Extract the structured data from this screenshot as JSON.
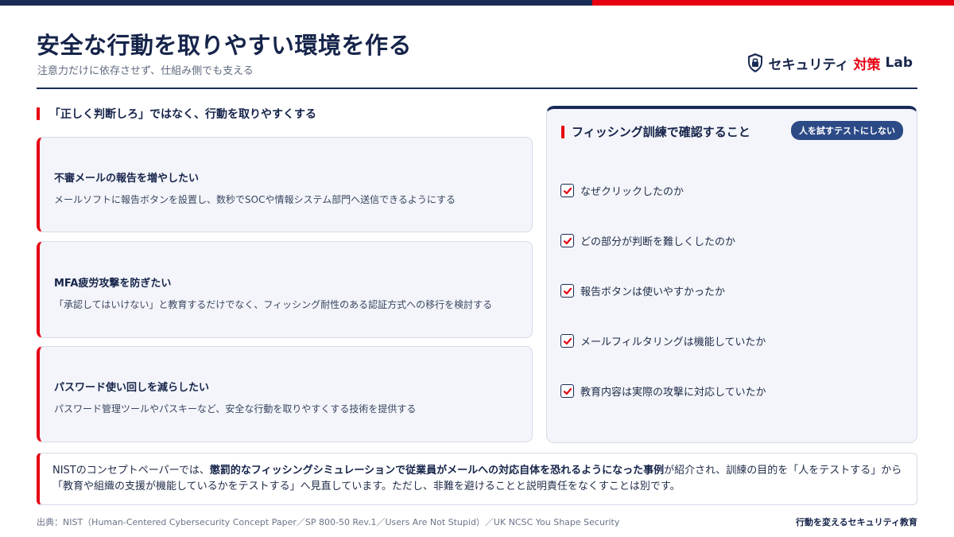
{
  "colors": {
    "navy": "#1a2b55",
    "accent_red": "#e60012",
    "card_bg": "#f3f5fa",
    "pill_bg": "#2c4a86"
  },
  "header": {
    "title": "安全な行動を取りやすい環境を作る",
    "subtitle": "注意力だけに依存させず、仕組み側でも支える"
  },
  "brand": {
    "icon": "shield-lock-icon",
    "name_main": "セキュリティ",
    "name_accent": "対策",
    "name_suffix": "Lab"
  },
  "left": {
    "heading": "「正しく判断しろ」ではなく、行動を取りやすくする",
    "cards": [
      {
        "title": "不審メールの報告を増やしたい",
        "desc": "メールソフトに報告ボタンを設置し、数秒でSOCや情報システム部門へ送信できるようにする"
      },
      {
        "title": "MFA疲労攻撃を防ぎたい",
        "desc": "「承認してはいけない」と教育するだけでなく、フィッシング耐性のある認証方式への移行を検討する"
      },
      {
        "title": "パスワード使い回しを減らしたい",
        "desc": "パスワード管理ツールやパスキーなど、安全な行動を取りやすくする技術を提供する"
      }
    ]
  },
  "right": {
    "heading": "フィッシング訓練で確認すること",
    "pill": "人を試すテストにしない",
    "items": [
      "なぜクリックしたのか",
      "どの部分が判断を難しくしたのか",
      "報告ボタンは使いやすかったか",
      "メールフィルタリングは機能していたか",
      "教育内容は実際の攻撃に対応していたか"
    ]
  },
  "note": {
    "part1": "NISTのコンセプトペーパーでは、",
    "bold": "懲罰的なフィッシングシミュレーションで従業員がメールへの対応自体を恐れるようになった事例",
    "part2": "が紹介され、訓練の目的を「人をテストする」から「教育や組織の支援が機能しているかをテストする」へ見直しています。ただし、非難を避けることと説明責任をなくすことは別です。"
  },
  "footer": {
    "source": "出典：NIST（Human-Centered Cybersecurity Concept Paper／SP 800-50 Rev.1／Users Are Not Stupid）／UK NCSC You Shape Security",
    "tagline": "行動を変えるセキュリティ教育"
  }
}
